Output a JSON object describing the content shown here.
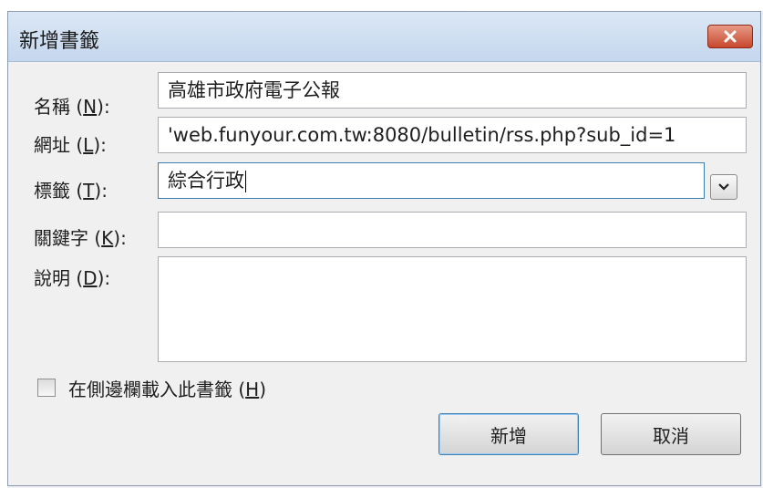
{
  "dialog": {
    "title": "新增書籤",
    "close_icon": "close-x-icon"
  },
  "form": {
    "name_label_prefix": "名稱 (",
    "name_label_key": "N",
    "name_label_suffix": "):",
    "name_value": "高雄市政府電子公報",
    "url_label_prefix": "網址 (",
    "url_label_key": "L",
    "url_label_suffix": "):",
    "url_value": "'web.funyour.com.tw:8080/bulletin/rss.php?sub_id=1",
    "tags_label_prefix": "標籤 (",
    "tags_label_key": "T",
    "tags_label_suffix": "):",
    "tags_value": "綜合行政",
    "keyword_label_prefix": "關鍵字 (",
    "keyword_label_key": "K",
    "keyword_label_suffix": "):",
    "keyword_value": "",
    "desc_label_prefix": "說明 (",
    "desc_label_key": "D",
    "desc_label_suffix": "):",
    "desc_value": ""
  },
  "sidebar_checkbox": {
    "label_prefix": "在側邊欄載入此書籤 (",
    "label_key": "H",
    "label_suffix": ")",
    "checked": false
  },
  "buttons": {
    "add": "新增",
    "cancel": "取消"
  }
}
